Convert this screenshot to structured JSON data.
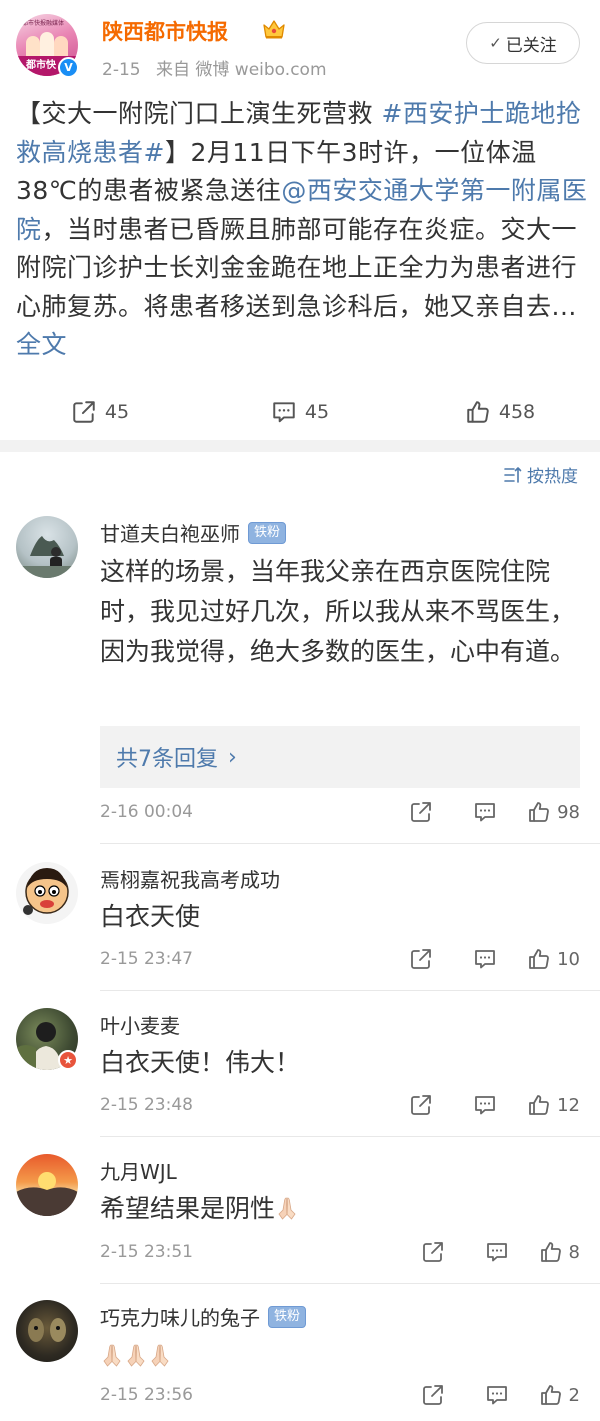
{
  "post": {
    "author": "陕西都市快报",
    "date": "2-15",
    "source": "来自 微博 weibo.com",
    "follow_label": "已关注",
    "avatar_brand": "都市快",
    "avatar_banner": "都市快报融媒体",
    "text_parts": {
      "p1": "【交大一附院门口上演生死营救 ",
      "tag": "#西安护士跪地抢救高烧患者#",
      "p2": "】2月11日下午3时许，一位体温38℃的患者被紧急送往",
      "mention": "@西安交通大学第一附属医院",
      "p3": "，当时患者已昏厥且肺部可能存在炎症。交大一附院门诊护士长刘金金跪在地上正全力为患者进行心肺复苏。将患者移送到急诊科后，她又亲自去... ",
      "more": "全文"
    },
    "repost_count": "45",
    "comment_count": "45",
    "like_count": "458"
  },
  "sort_label": "按热度",
  "comments": [
    {
      "name": "甘道夫白袍巫师",
      "badge": "铁粉",
      "text": "这样的场景，当年我父亲在西京医院住院时，我见过好几次，所以我从来不骂医生，因为我觉得，绝大多数的医生，心中有道。",
      "reply_label": "共7条回复",
      "time": "2-16 00:04",
      "likes": "98"
    },
    {
      "name": "焉栩嘉祝我高考成功",
      "text": "白衣天使",
      "time": "2-15 23:47",
      "likes": "10"
    },
    {
      "name": "叶小麦麦",
      "text": "白衣天使！伟大！",
      "time": "2-15 23:48",
      "likes": "12"
    },
    {
      "name": "九月WJL",
      "text": "希望结果是阴性",
      "emoji": "praying-hands",
      "time": "2-15 23:51",
      "likes": "8"
    },
    {
      "name": "巧克力味儿的兔子",
      "badge": "铁粉",
      "emoji": "praying-hands-x3",
      "time": "2-15 23:56",
      "likes": "2"
    }
  ],
  "colors": {
    "author": "#f56a00",
    "link": "#4e7aac",
    "muted": "#999999",
    "divider": "#f2f2f2"
  }
}
